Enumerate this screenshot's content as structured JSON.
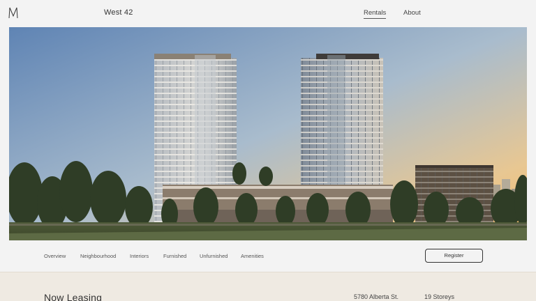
{
  "header": {
    "logo_icon": "m-monogram-icon",
    "project_title": "West 42",
    "nav": [
      {
        "label": "Rentals",
        "active": true
      },
      {
        "label": "About",
        "active": false
      }
    ]
  },
  "hero": {
    "image": "rendering-of-two-residential-towers-at-sunset-icon",
    "sky_colors": [
      "#6d8fbb",
      "#b6c6d3",
      "#f2c27e"
    ]
  },
  "subnav": {
    "items": [
      "Overview",
      "Neighbourhood",
      "Interiors",
      "Furnished",
      "Unfurnished",
      "Amenities"
    ],
    "register_label": "Register"
  },
  "leasing": {
    "title": "Now Leasing",
    "address": "5780 Alberta St.",
    "storeys": "19 Storeys"
  },
  "colors": {
    "page_bg": "#f3f3f3",
    "band_bg": "#efeae2",
    "text": "#333333"
  }
}
